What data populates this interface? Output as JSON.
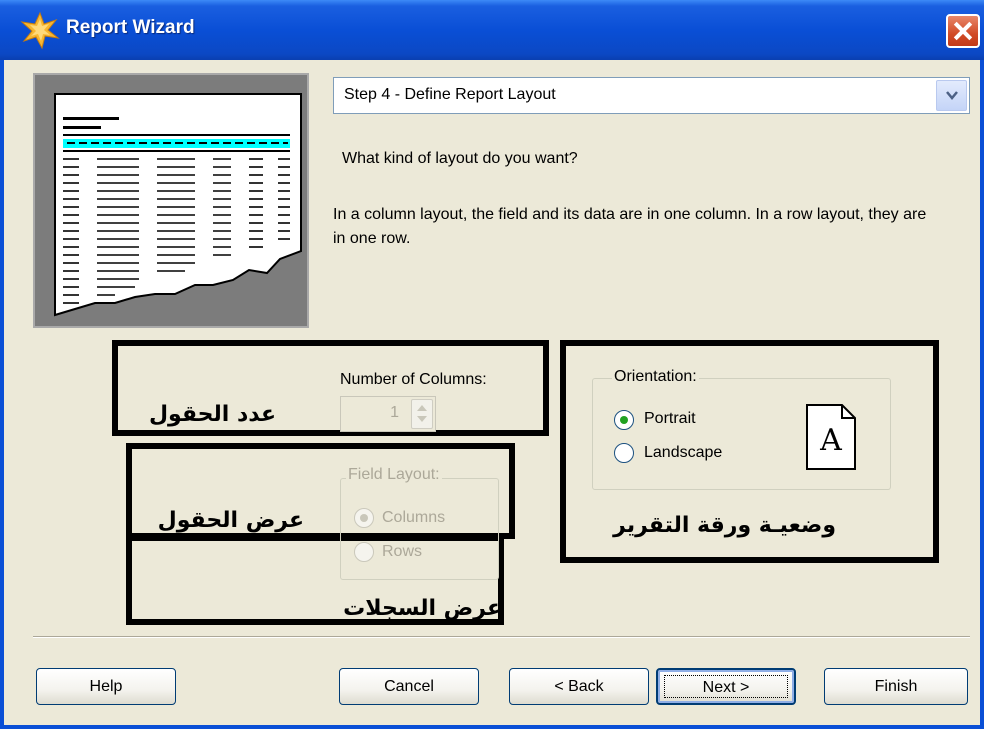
{
  "window": {
    "title": "Report Wizard"
  },
  "step_selector": {
    "value": "Step 4 - Define Report Layout"
  },
  "question": "What kind of layout do you want?",
  "description": "In a column layout, the field and its data are in one column. In a row layout, they are in one row.",
  "columns": {
    "label": "Number of Columns:",
    "value": "1"
  },
  "field_layout": {
    "label": "Field Layout:",
    "options": [
      {
        "label": "Columns",
        "selected": true
      },
      {
        "label": "Rows",
        "selected": false
      }
    ]
  },
  "orientation": {
    "label": "Orientation:",
    "options": [
      {
        "label": "Portrait",
        "selected": true
      },
      {
        "label": "Landscape",
        "selected": false
      }
    ],
    "icon_letter": "A"
  },
  "annotations": {
    "columns_count": "عدد الحقول",
    "field_layout": "عرض الحقول",
    "records_layout": "عرض السجلات",
    "orientation": "وضعيـة ورقة التقرير"
  },
  "buttons": {
    "help": "Help",
    "cancel": "Cancel",
    "back": "< Back",
    "next": "Next >",
    "finish": "Finish"
  },
  "colors": {
    "title_bar": "#0a4fd6",
    "annotation_border": "#000000",
    "radio_selected": "#21a121",
    "preview_highlight": "#00ffff"
  }
}
